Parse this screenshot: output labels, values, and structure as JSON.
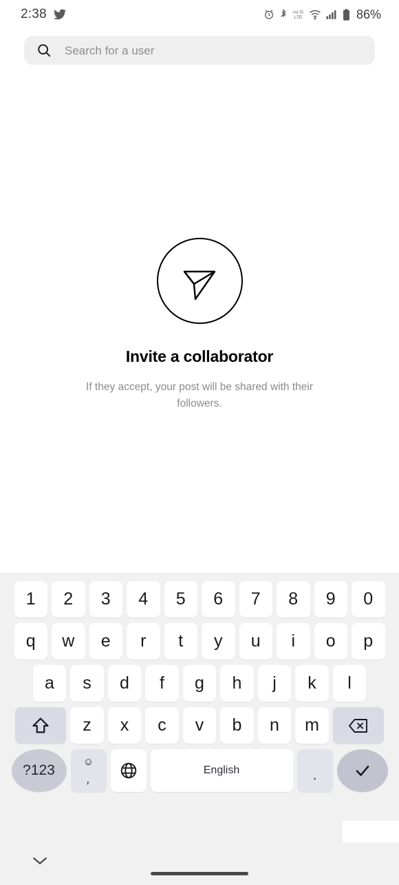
{
  "status_bar": {
    "time": "2:38",
    "app_icon": "twitter-bird-icon",
    "icons": [
      "alarm-icon",
      "bluetooth-icon",
      "volte-icon",
      "wifi-icon",
      "cellular-signal-icon",
      "battery-icon"
    ],
    "battery_percent": "86%"
  },
  "search": {
    "icon": "search-icon",
    "placeholder": "Search for a user",
    "value": "",
    "caret_color": "#13a884",
    "background": "#efefef"
  },
  "empty_state": {
    "icon": "send-paper-plane-icon",
    "title": "Invite a collaborator",
    "subtitle": "If they accept, your post will be shared with their followers."
  },
  "keyboard": {
    "background": "#f1f1f1",
    "rows": {
      "numbers": [
        "1",
        "2",
        "3",
        "4",
        "5",
        "6",
        "7",
        "8",
        "9",
        "0"
      ],
      "top": [
        "q",
        "w",
        "e",
        "r",
        "t",
        "y",
        "u",
        "i",
        "o",
        "p"
      ],
      "middle": [
        "a",
        "s",
        "d",
        "f",
        "g",
        "h",
        "j",
        "k",
        "l"
      ],
      "bottom": [
        "z",
        "x",
        "c",
        "v",
        "b",
        "n",
        "m"
      ]
    },
    "shift_key": "shift-icon",
    "backspace_key": "backspace-icon",
    "symbols_key": "?123",
    "emoji_key": "☺",
    "comma_key": ",",
    "globe_key": "globe-language-icon",
    "space_key": "English",
    "period_key": ".",
    "enter_key": "checkmark-icon"
  },
  "nav_bar": {
    "hide_keyboard": "chevron-down-icon",
    "home_indicator": "home-indicator"
  }
}
